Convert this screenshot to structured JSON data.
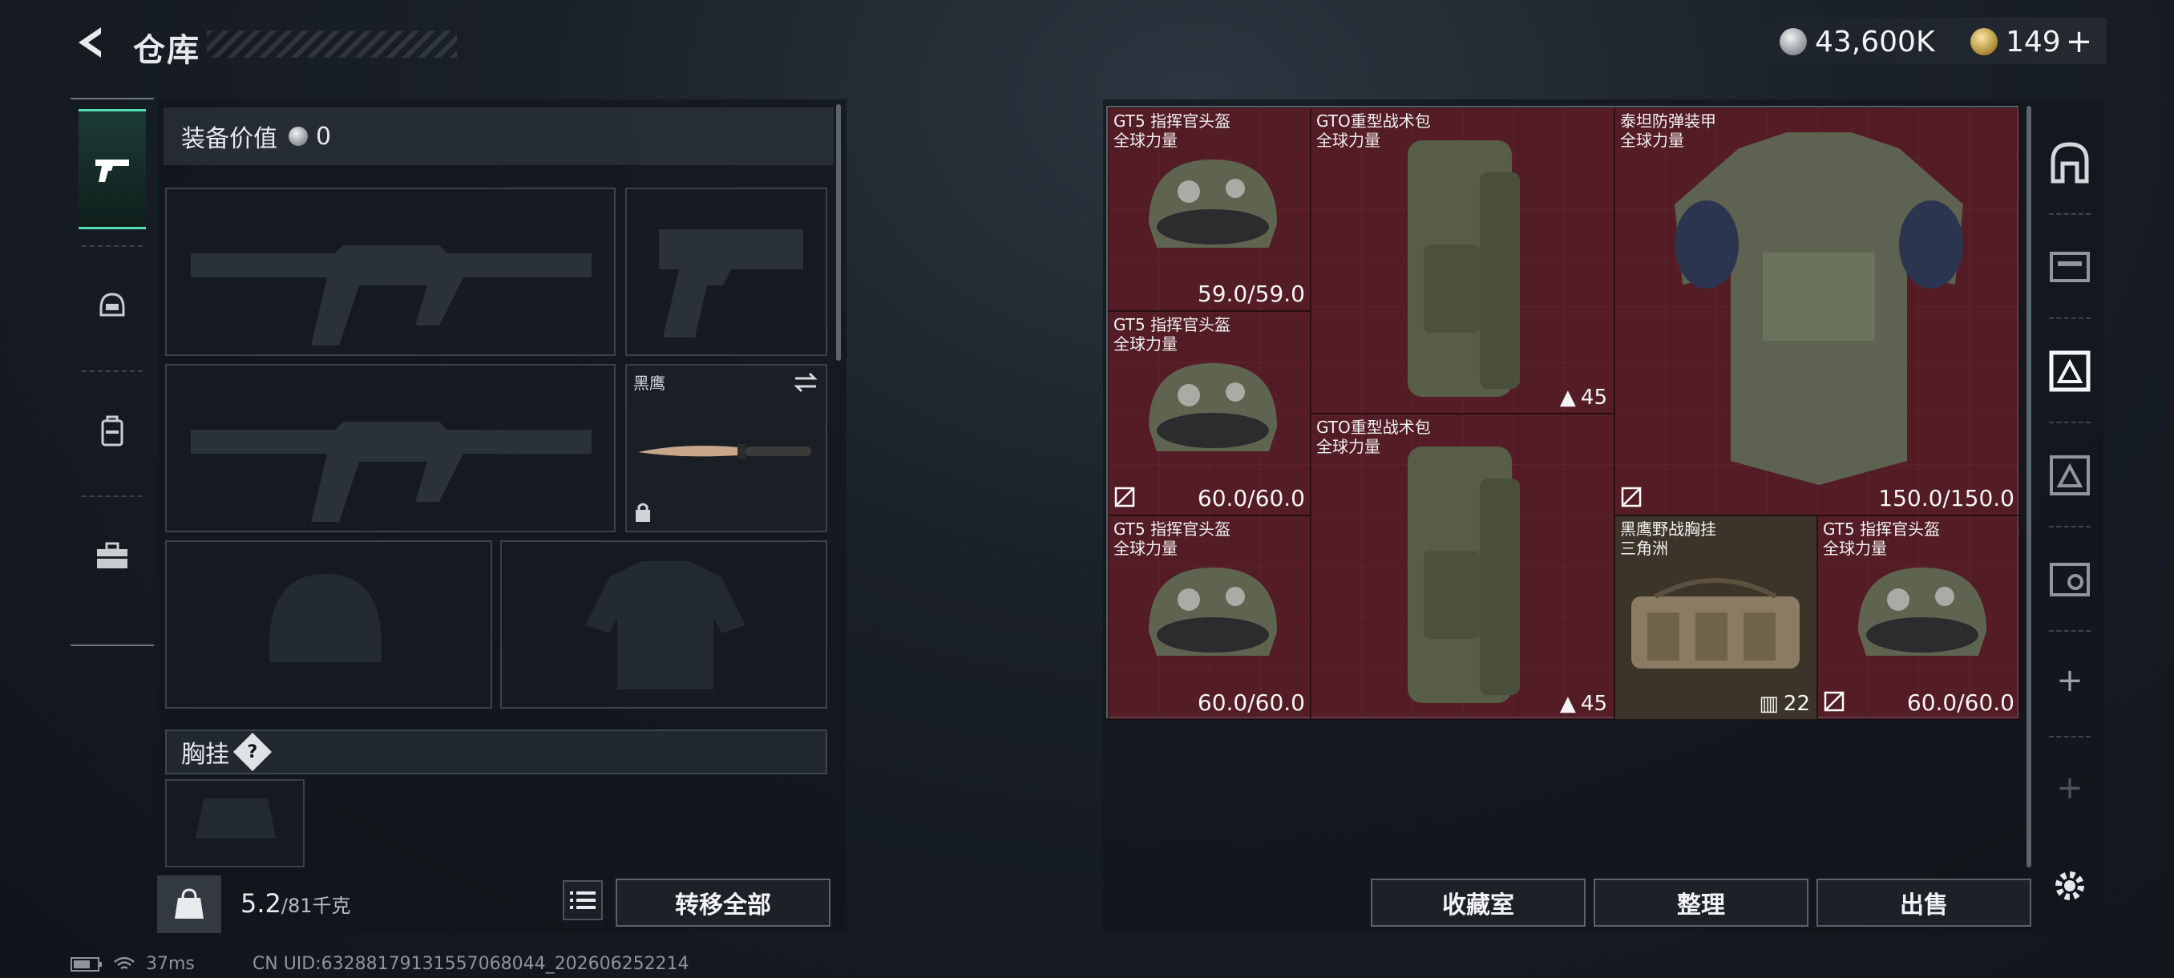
{
  "header": {
    "title": "仓库",
    "currency_primary": "43,600K",
    "currency_secondary": "149",
    "plus": "+"
  },
  "loadout": {
    "value_label": "装备价值",
    "value": "0",
    "knife_name": "黑鹰",
    "chest_section": "胸挂",
    "help": "?",
    "weight_current": "5.2",
    "weight_max": "/81千克",
    "transfer_all": "转移全部"
  },
  "stash": {
    "items": [
      {
        "name": "GT5 指挥官头盔",
        "sub": "全球力量",
        "durability": "59.0/59.0"
      },
      {
        "name": "GTO重型战术包",
        "sub": "全球力量",
        "count": "45"
      },
      {
        "name": "泰坦防弹装甲",
        "sub": "全球力量",
        "durability": "150.0/150.0"
      },
      {
        "name": "GT5 指挥官头盔",
        "sub": "全球力量",
        "durability": "60.0/60.0"
      },
      {
        "name": "GTO重型战术包",
        "sub": "全球力量",
        "count": "45"
      },
      {
        "name": "GT5 指挥官头盔",
        "sub": "全球力量",
        "durability": "60.0/60.0"
      },
      {
        "name": "黑鹰野战胸挂",
        "sub": "三角洲",
        "count": "22"
      },
      {
        "name": "GT5 指挥官头盔",
        "sub": "全球力量",
        "durability": "60.0/60.0"
      }
    ],
    "buttons": {
      "vault": "收藏室",
      "sort": "整理",
      "sell": "出售"
    },
    "side_plus": "+"
  },
  "status": {
    "ping": "37ms",
    "uid": "CN UID:632881791315570680​44_202606252214"
  },
  "colors": {
    "accent": "#4fe0b3",
    "stash_bg": "#4a1c22"
  },
  "icons": [
    "back-arrow-icon",
    "pistol-icon",
    "helmet-icon",
    "backpack-icon",
    "toolbox-icon",
    "lock-icon",
    "swap-icon",
    "list-icon",
    "settings-gear-icon"
  ]
}
